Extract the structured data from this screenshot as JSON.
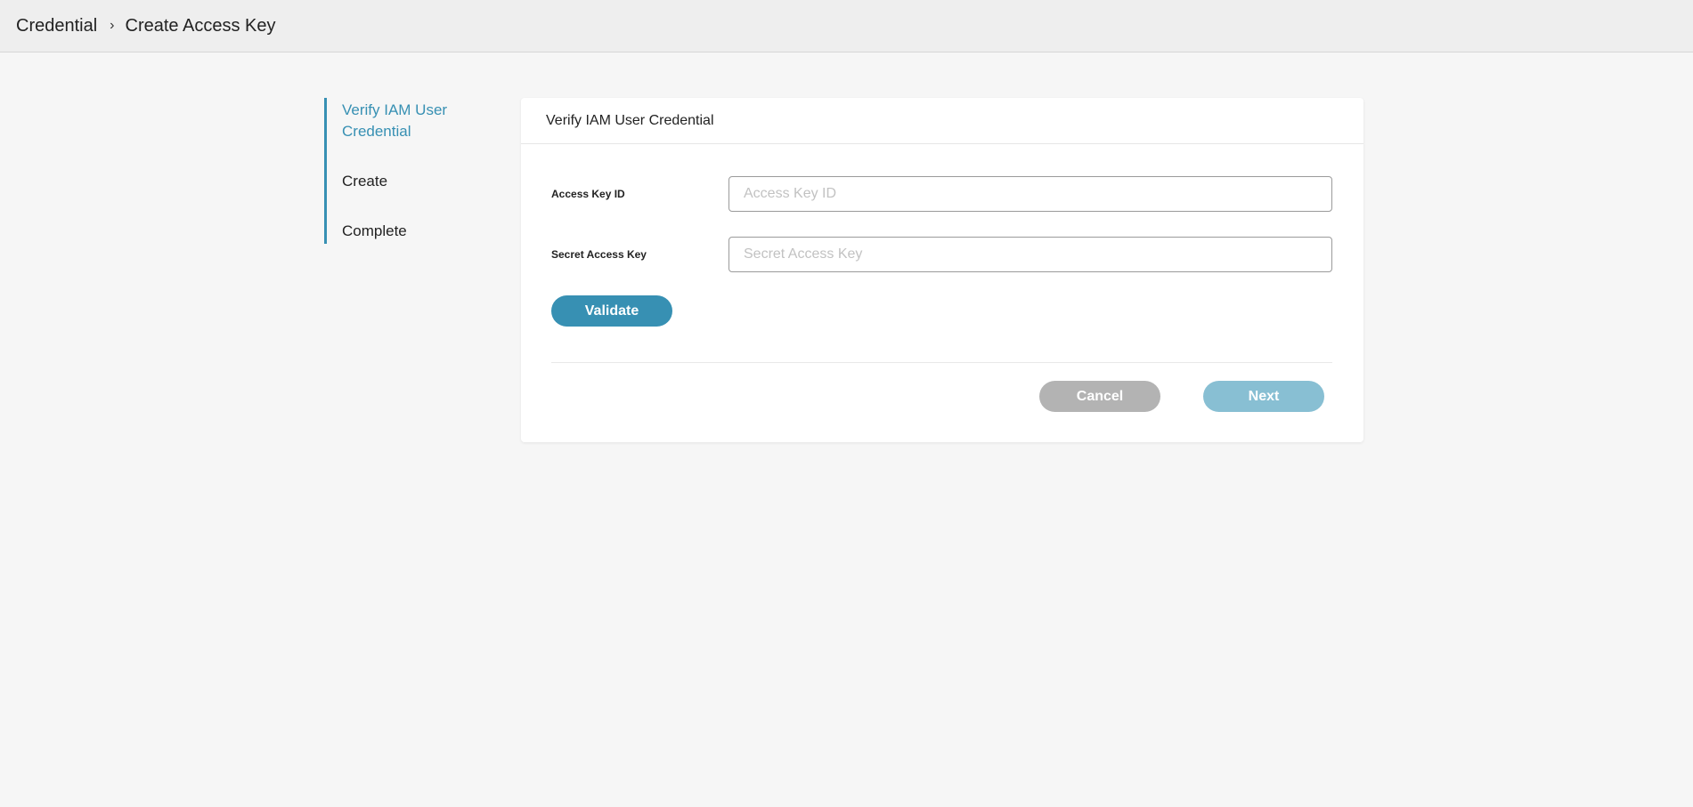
{
  "breadcrumb": {
    "items": [
      "Credential",
      "Create Access Key"
    ],
    "separator": "›"
  },
  "steps": [
    {
      "label": "Verify IAM User Credential",
      "active": true
    },
    {
      "label": "Create",
      "active": false
    },
    {
      "label": "Complete",
      "active": false
    }
  ],
  "card": {
    "title": "Verify IAM User Credential",
    "fields": {
      "access_key_id": {
        "label": "Access Key ID",
        "value": "",
        "placeholder": "Access Key ID"
      },
      "secret_access_key": {
        "label": "Secret Access Key",
        "value": "",
        "placeholder": "Secret Access Key"
      }
    },
    "validate_label": "Validate",
    "cancel_label": "Cancel",
    "next_label": "Next"
  },
  "colors": {
    "accent": "#3790b3",
    "next_disabled": "#88bfd3",
    "cancel": "#b3b3b3",
    "background": "#f6f6f6"
  }
}
